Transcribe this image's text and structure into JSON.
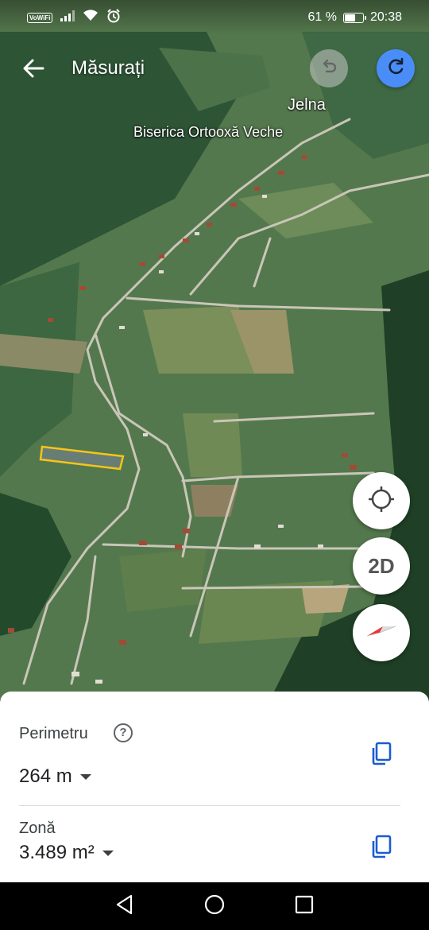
{
  "status_bar": {
    "vowifi": "VoWiFi",
    "battery_text": "61 %",
    "battery_level": 0.61,
    "time": "20:38",
    "icons": [
      "signal-icon",
      "wifi-icon",
      "alarm-icon",
      "battery-icon"
    ]
  },
  "app_bar": {
    "title": "Măsurați",
    "back_icon": "arrow-back-icon",
    "undo_icon": "undo-icon",
    "redo_icon": "redo-icon",
    "accent_color": "#4b8df8"
  },
  "map": {
    "labels": {
      "town": "Jelna",
      "landmark": "Biserica Ortooxă Veche"
    },
    "measured_polygon_color": "#f5c518"
  },
  "map_controls": {
    "locate_icon": "my-location-icon",
    "view_mode": "2D",
    "compass_icon": "compass-icon"
  },
  "measurements": {
    "perimeter": {
      "label": "Perimetru",
      "value": "264 m"
    },
    "area": {
      "label": "Zonă",
      "value": "3.489 m²"
    },
    "copy_icon": "copy-icon",
    "help_icon": "help-icon"
  },
  "nav_bar": {
    "icons": [
      "back-triangle-icon",
      "home-circle-icon",
      "recents-square-icon"
    ]
  }
}
